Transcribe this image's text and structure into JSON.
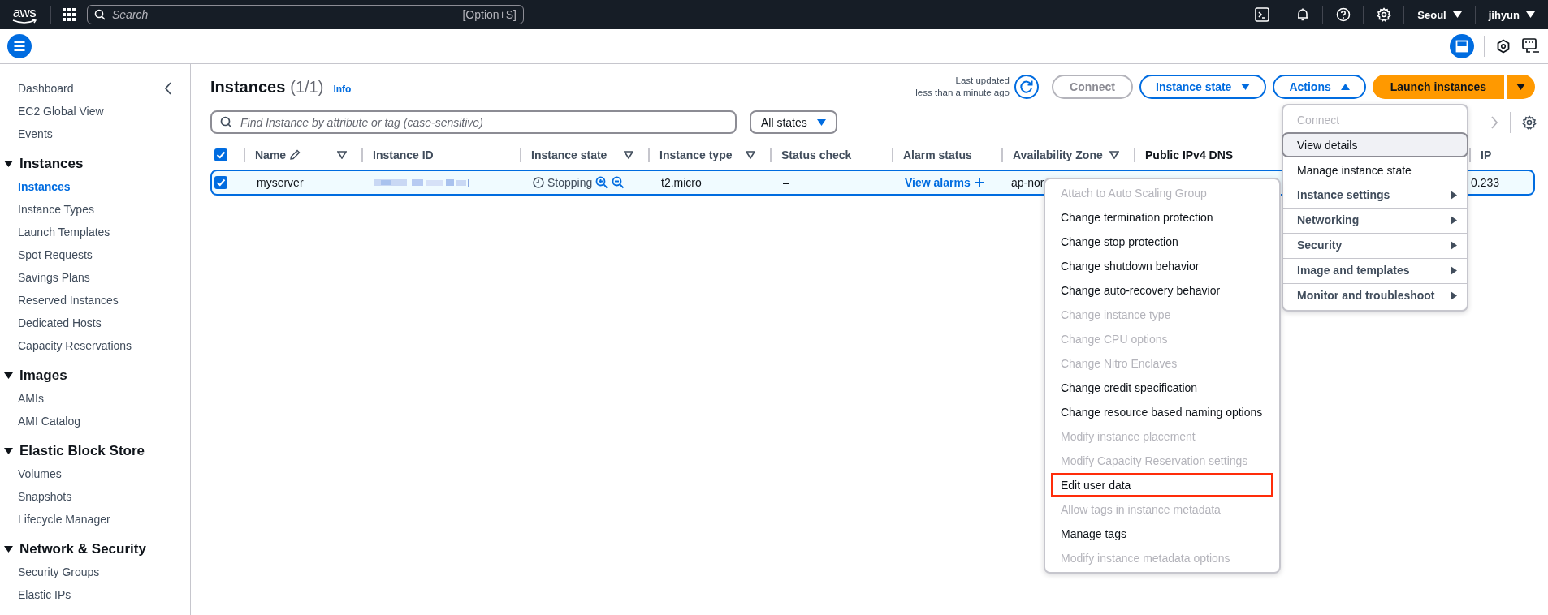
{
  "top_bar": {
    "logo": "aws",
    "search": {
      "placeholder": "Search",
      "shortcut": "[Option+S]"
    },
    "region": "Seoul",
    "user": "jihyun"
  },
  "sidebar": {
    "top_items": [
      {
        "label": "Dashboard",
        "selected": false
      },
      {
        "label": "EC2 Global View",
        "selected": false
      },
      {
        "label": "Events",
        "selected": false
      }
    ],
    "sections": [
      {
        "title": "Instances",
        "expanded": true,
        "items": [
          {
            "label": "Instances",
            "selected": true
          },
          {
            "label": "Instance Types",
            "selected": false
          },
          {
            "label": "Launch Templates",
            "selected": false
          },
          {
            "label": "Spot Requests",
            "selected": false
          },
          {
            "label": "Savings Plans",
            "selected": false
          },
          {
            "label": "Reserved Instances",
            "selected": false
          },
          {
            "label": "Dedicated Hosts",
            "selected": false
          },
          {
            "label": "Capacity Reservations",
            "selected": false
          }
        ]
      },
      {
        "title": "Images",
        "expanded": true,
        "items": [
          {
            "label": "AMIs",
            "selected": false
          },
          {
            "label": "AMI Catalog",
            "selected": false
          }
        ]
      },
      {
        "title": "Elastic Block Store",
        "expanded": true,
        "items": [
          {
            "label": "Volumes",
            "selected": false
          },
          {
            "label": "Snapshots",
            "selected": false
          },
          {
            "label": "Lifecycle Manager",
            "selected": false
          }
        ]
      },
      {
        "title": "Network & Security",
        "expanded": true,
        "items": [
          {
            "label": "Security Groups",
            "selected": false
          },
          {
            "label": "Elastic IPs",
            "selected": false
          }
        ]
      }
    ]
  },
  "header": {
    "title": "Instances",
    "count": "(1/1)",
    "info": "Info",
    "last_updated": "Last updated",
    "last_updated_value": "less than a minute ago",
    "buttons": [
      {
        "label": "Connect",
        "kind": "plain",
        "disabled": true
      },
      {
        "label": "Instance state",
        "kind": "dropdown",
        "expanded": false,
        "disabled": false
      },
      {
        "label": "Actions",
        "kind": "dropdown",
        "expanded": true,
        "disabled": false
      },
      {
        "label": "Launch instances",
        "kind": "primary",
        "disabled": false
      }
    ]
  },
  "filter": {
    "placeholder": "Find Instance by attribute or tag (case-sensitive)",
    "states": "All states"
  },
  "table": {
    "select_all": true,
    "columns": [
      {
        "label": "Name",
        "editable": true,
        "filter": true,
        "sorted": false
      },
      {
        "label": "Instance ID",
        "filter": false,
        "sorted": false
      },
      {
        "label": "Instance state",
        "filter": true,
        "sorted": false
      },
      {
        "label": "Instance type",
        "filter": true,
        "sorted": false
      },
      {
        "label": "Status check",
        "filter": false,
        "sorted": false
      },
      {
        "label": "Alarm status",
        "filter": false,
        "sorted": false
      },
      {
        "label": "Availability Zone",
        "filter": true,
        "sorted": false
      },
      {
        "label": "Public IPv4 DNS",
        "filter": false,
        "sorted": true
      },
      {
        "label": "IP",
        "filter": false,
        "sorted": false
      }
    ],
    "rows": [
      {
        "checked": true,
        "selected": true,
        "name": "myserver",
        "state": {
          "label": "Stopping",
          "kind": "pending"
        },
        "type": "t2.micro",
        "status_check": "–",
        "alarm": "View alarms",
        "zone": "ap-nor",
        "ip": "0.233"
      }
    ]
  },
  "actions_menu": [
    {
      "label": "Connect",
      "disabled": true,
      "highlighted": false,
      "submenu": false
    },
    {
      "label": "View details",
      "disabled": false,
      "highlighted": true,
      "submenu": false
    },
    {
      "label": "Manage instance state",
      "disabled": false,
      "highlighted": false,
      "submenu": false
    },
    {
      "label": "Instance settings",
      "disabled": false,
      "highlighted": false,
      "submenu": true
    },
    {
      "label": "Networking",
      "disabled": false,
      "highlighted": false,
      "submenu": true
    },
    {
      "label": "Security",
      "disabled": false,
      "highlighted": false,
      "submenu": true
    },
    {
      "label": "Image and templates",
      "disabled": false,
      "highlighted": false,
      "submenu": true
    },
    {
      "label": "Monitor and troubleshoot",
      "disabled": false,
      "highlighted": false,
      "submenu": true
    }
  ],
  "settings_menu": [
    {
      "label": "Attach to Auto Scaling Group",
      "disabled": true,
      "outlined": false
    },
    {
      "label": "Change termination protection",
      "disabled": false,
      "outlined": false
    },
    {
      "label": "Change stop protection",
      "disabled": false,
      "outlined": false
    },
    {
      "label": "Change shutdown behavior",
      "disabled": false,
      "outlined": false
    },
    {
      "label": "Change auto-recovery behavior",
      "disabled": false,
      "outlined": false
    },
    {
      "label": "Change instance type",
      "disabled": true,
      "outlined": false
    },
    {
      "label": "Change CPU options",
      "disabled": true,
      "outlined": false
    },
    {
      "label": "Change Nitro Enclaves",
      "disabled": true,
      "outlined": false
    },
    {
      "label": "Change credit specification",
      "disabled": false,
      "outlined": false
    },
    {
      "label": "Change resource based naming options",
      "disabled": false,
      "outlined": false
    },
    {
      "label": "Modify instance placement",
      "disabled": true,
      "outlined": false
    },
    {
      "label": "Modify Capacity Reservation settings",
      "disabled": true,
      "outlined": false
    },
    {
      "label": "Edit user data",
      "disabled": false,
      "outlined": true
    },
    {
      "label": "Allow tags in instance metadata",
      "disabled": true,
      "outlined": false
    },
    {
      "label": "Manage tags",
      "disabled": false,
      "outlined": false
    },
    {
      "label": "Modify instance metadata options",
      "disabled": true,
      "outlined": false
    }
  ]
}
